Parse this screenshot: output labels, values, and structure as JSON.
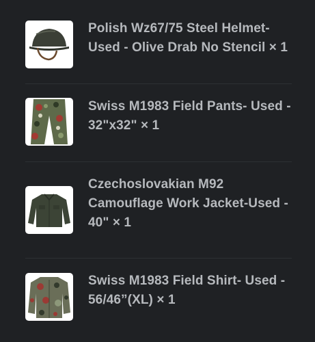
{
  "items": [
    {
      "name": "Polish Wz67/75 Steel Helmet- Used - Olive Drab No Stencil",
      "quantity_text": "× 1",
      "image": "helmet-image"
    },
    {
      "name": "Swiss M1983 Field Pants- Used - 32\"x32\"",
      "quantity_text": "× 1",
      "image": "camo-pants-image"
    },
    {
      "name": "Czechoslovakian M92 Camouflage Work Jacket-Used - 40\"",
      "quantity_text": "× 1",
      "image": "work-jacket-image"
    },
    {
      "name": "Swiss M1983 Field Shirt- Used - 56/46”(XL)",
      "quantity_text": "× 1",
      "image": "camo-shirt-image"
    }
  ],
  "colors": {
    "background": "#1f2124",
    "text": "#b6b9bd",
    "divider": "#2d3034",
    "thumbnail_bg": "#ffffff"
  }
}
